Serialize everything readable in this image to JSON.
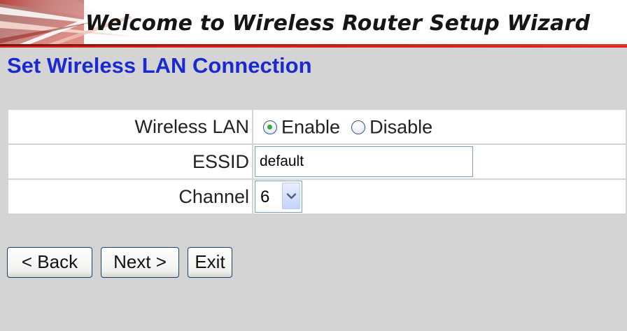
{
  "banner": {
    "title": "Welcome to Wireless Router Setup Wizard"
  },
  "page": {
    "title": "Set Wireless LAN Connection"
  },
  "form": {
    "wireless_lan": {
      "label": "Wireless LAN",
      "options": [
        {
          "label": "Enable",
          "checked": true
        },
        {
          "label": "Disable",
          "checked": false
        }
      ]
    },
    "essid": {
      "label": "ESSID",
      "value": "default"
    },
    "channel": {
      "label": "Channel",
      "value": "6"
    }
  },
  "buttons": {
    "back": "< Back",
    "next": "Next >",
    "exit": "Exit"
  },
  "colors": {
    "page_title": "#1a2ad0",
    "banner_rule": "#e22018",
    "background": "#d4d4d4"
  }
}
